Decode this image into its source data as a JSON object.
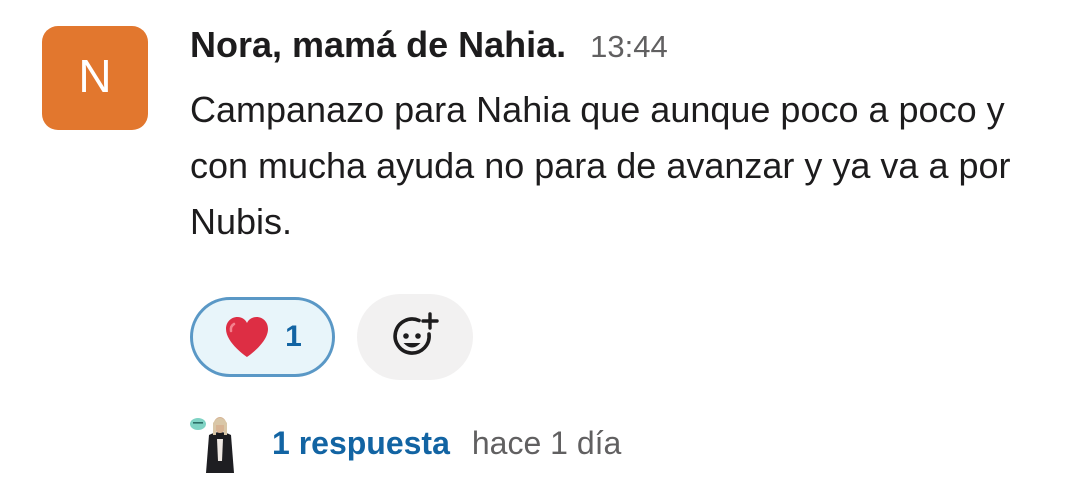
{
  "message": {
    "avatar_initial": "N",
    "avatar_color": "#e2772e",
    "author": "Nora, mamá de Nahia.",
    "time": "13:44",
    "text": "Campanazo para Nahia que aunque poco a poco y con mucha ayuda no para de avanzar y ya va a por Nubis."
  },
  "reactions": [
    {
      "emoji": "heart-icon",
      "count": "1"
    }
  ],
  "add_reaction_icon": "smiley-plus-icon",
  "thread": {
    "reply_avatar_icon": "user-photo-icon",
    "reply_count": "1 respuesta",
    "last_reply": "hace 1 día"
  },
  "colors": {
    "link": "#1264a3",
    "reaction_border": "#5a98c6",
    "reaction_bg": "#e8f5fa",
    "muted": "#616061"
  }
}
